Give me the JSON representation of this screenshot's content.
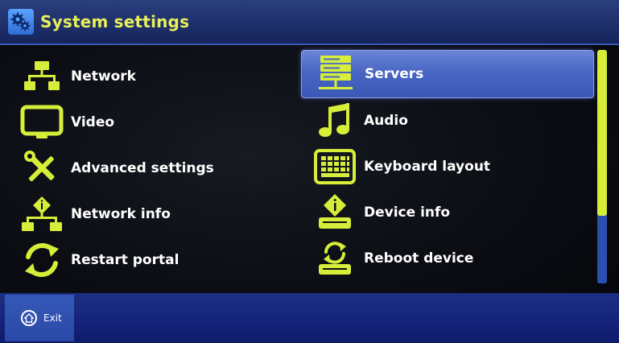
{
  "header": {
    "title": "System settings",
    "icon": "gears-icon"
  },
  "menu": {
    "left": [
      {
        "label": "Network",
        "icon": "network-icon"
      },
      {
        "label": "Video",
        "icon": "monitor-icon"
      },
      {
        "label": "Advanced settings",
        "icon": "tools-icon"
      },
      {
        "label": "Network info",
        "icon": "network-info-icon"
      },
      {
        "label": "Restart portal",
        "icon": "refresh-icon"
      }
    ],
    "right": [
      {
        "label": "Servers",
        "icon": "server-icon",
        "selected": true
      },
      {
        "label": "Audio",
        "icon": "music-note-icon"
      },
      {
        "label": "Keyboard layout",
        "icon": "keyboard-icon"
      },
      {
        "label": "Device info",
        "icon": "device-info-icon"
      },
      {
        "label": "Reboot device",
        "icon": "reboot-icon"
      }
    ]
  },
  "footer": {
    "exit_label": "Exit",
    "exit_icon": "home-icon"
  },
  "colors": {
    "accent": "#d6ee3a",
    "title": "#e8f05a",
    "selection": "#4966c4",
    "header": "#1d2f6a",
    "footer": "#14237a"
  }
}
